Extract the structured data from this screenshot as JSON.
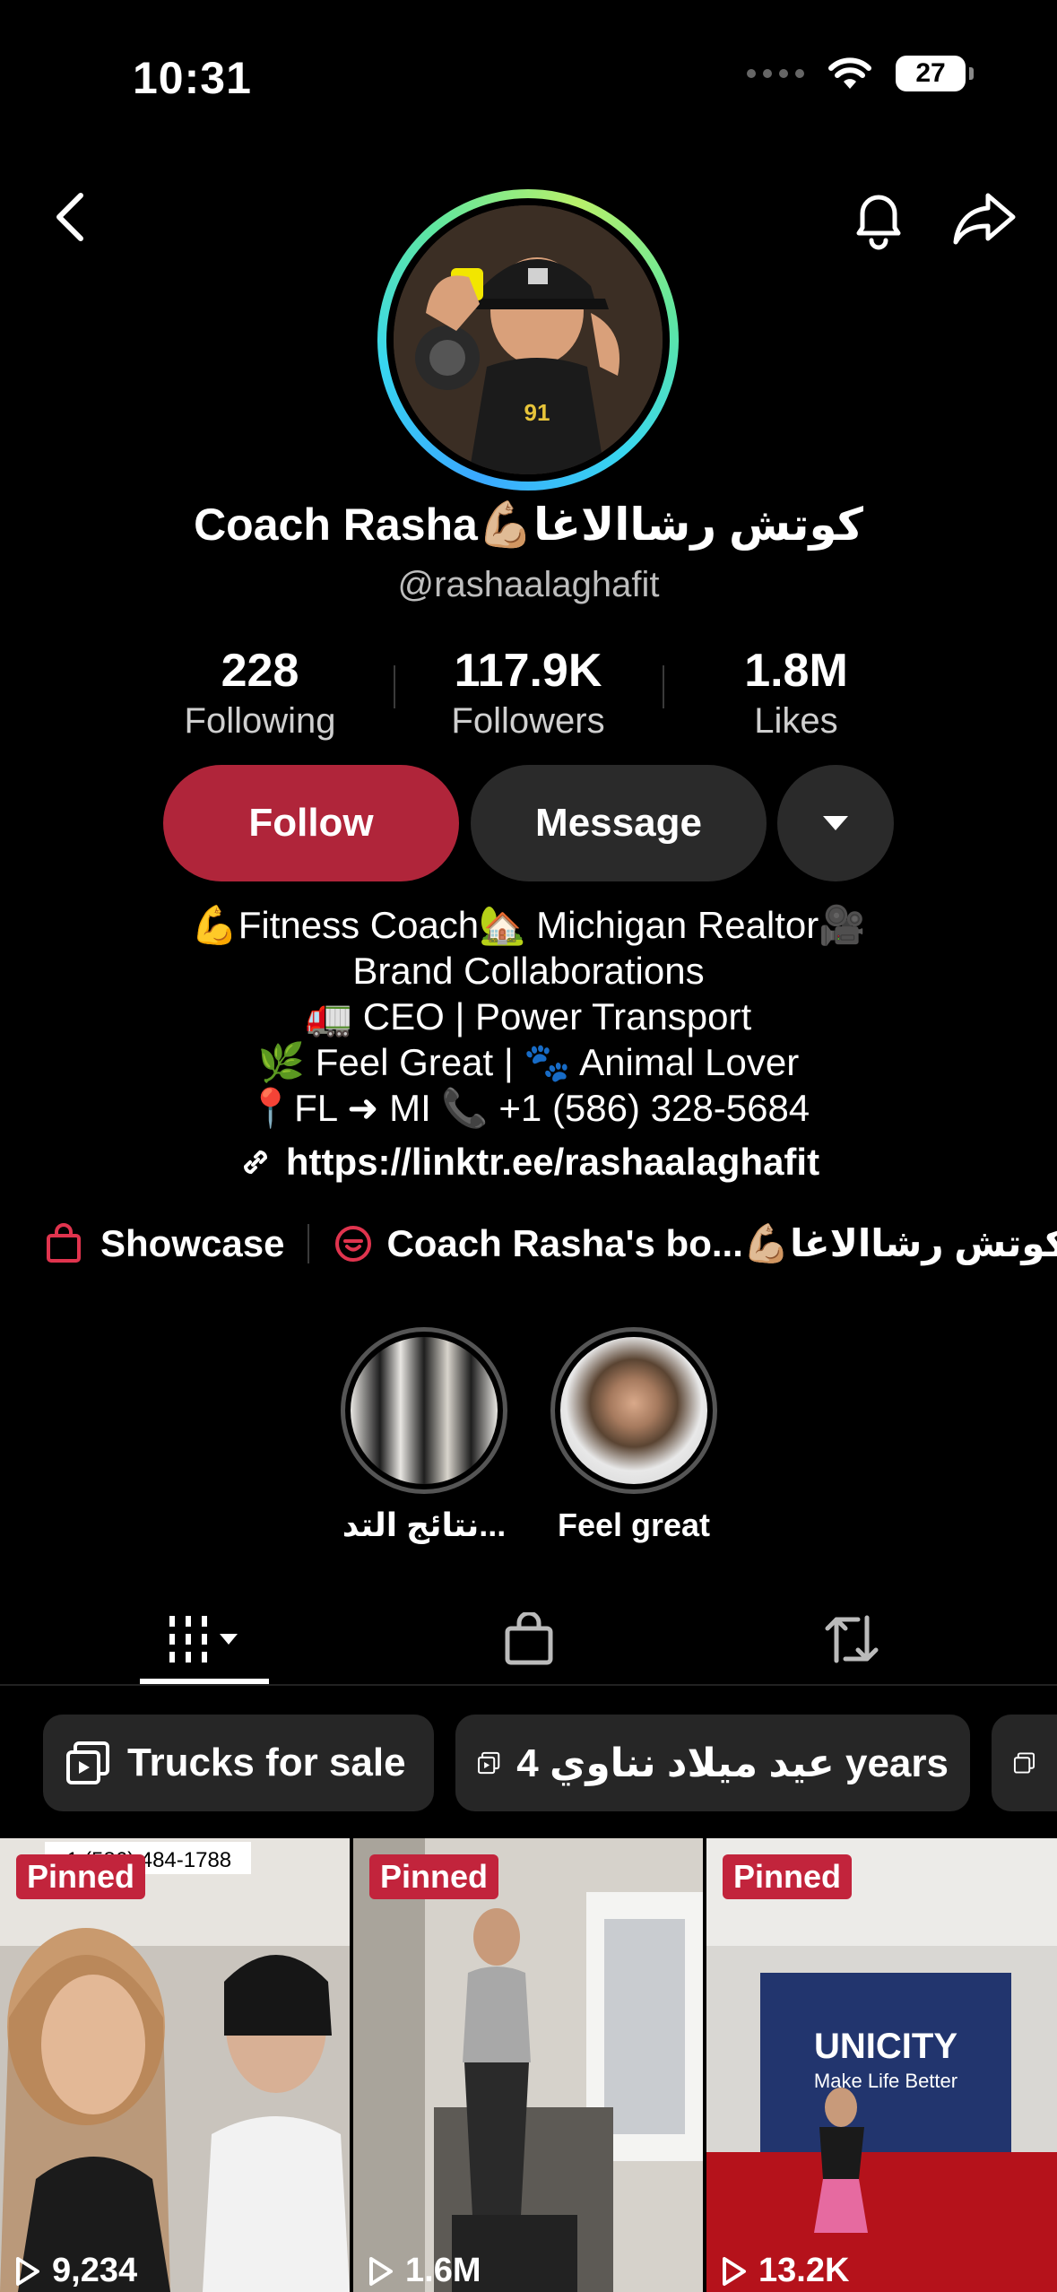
{
  "status_bar": {
    "time": "10:31",
    "battery": "27",
    "battery_level": 0.27
  },
  "profile": {
    "display_name": "Coach Rasha💪🏼كوتش رشاالاغا",
    "username": "@rashaalaghafit",
    "stats": [
      {
        "value": "228",
        "label": "Following"
      },
      {
        "value": "117.9K",
        "label": "Followers"
      },
      {
        "value": "1.8M",
        "label": "Likes"
      }
    ]
  },
  "buttons": {
    "follow": "Follow",
    "message": "Message"
  },
  "bio": {
    "lines": [
      "💪Fitness Coach🏡 Michigan Realtor🎥",
      "Brand Collaborations",
      "🚛 CEO | Power Transport",
      "🌿 Feel Great | 🐾 Animal Lover",
      "📍FL ➜ MI 📞 +1 (586) 328-5684"
    ],
    "link": "https://linktr.ee/rashaalaghafit"
  },
  "showcase": {
    "label": "Showcase",
    "shop_label": "Coach Rasha's bo...💪🏼كوتش رشاالاغا"
  },
  "highlights": [
    {
      "label": "نتائج التد..."
    },
    {
      "label": "Feel great"
    }
  ],
  "playlists": [
    {
      "label": "Trucks for sale"
    },
    {
      "label": "عيد ميلاد نناوي 4 years"
    }
  ],
  "videos": [
    {
      "pinned": "Pinned",
      "views": "9,234",
      "overlay": "+1 (586) 484-1788"
    },
    {
      "pinned": "Pinned",
      "views": "1.6M"
    },
    {
      "pinned": "Pinned",
      "views": "13.2K",
      "overlay": "UNICITY",
      "overlay_sub": "Make Life Better"
    }
  ],
  "colors": {
    "follow": "#b0253a",
    "pinned": "#c2243c",
    "button_dark": "#2a2a2a"
  }
}
